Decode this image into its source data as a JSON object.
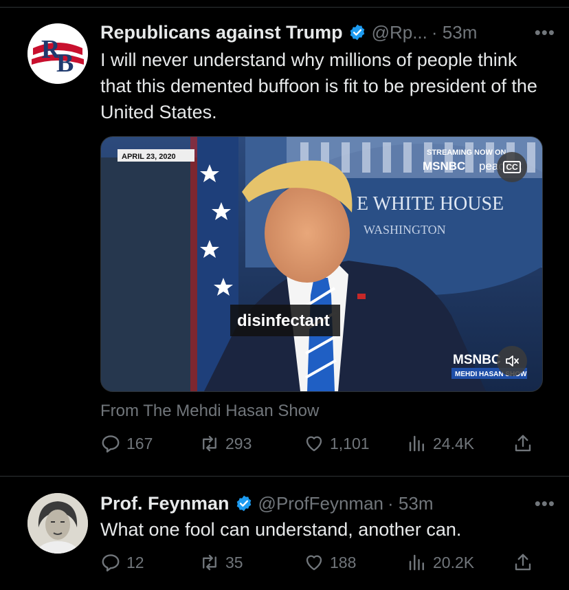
{
  "tweets": [
    {
      "avatar_text": "RB",
      "name": "Republicans against Trump",
      "handle": "@Rp...",
      "time": "· 53m",
      "text": "I will never understand why millions of people think that this demented buffoon is fit to be president of the United States.",
      "media": {
        "date_stamp": "APRIL 23, 2020",
        "streaming_label": "STREAMING NOW ON",
        "network": "MSNBC",
        "streaming_service": "peacock",
        "wall_text": "E WHITE HOUSE",
        "wall_subtext": "WASHINGTON",
        "caption": "disinfectant",
        "corner_network": "MSNBC",
        "corner_show": "MEHDI HASAN SHOW",
        "cc_label": "CC"
      },
      "source": "From The Mehdi Hasan Show",
      "stats": {
        "replies": "167",
        "retweets": "293",
        "likes": "1,101",
        "views": "24.4K"
      }
    },
    {
      "name": "Prof. Feynman",
      "handle": "@ProfFeynman",
      "time": "· 53m",
      "text": "What one fool can understand, another can.",
      "stats": {
        "replies": "12",
        "retweets": "35",
        "likes": "188",
        "views": "20.2K"
      }
    }
  ],
  "more_label": "•••",
  "colors": {
    "background": "#000000",
    "text": "#e7e9ea",
    "muted": "#71767b",
    "verified": "#1d9bf0"
  }
}
